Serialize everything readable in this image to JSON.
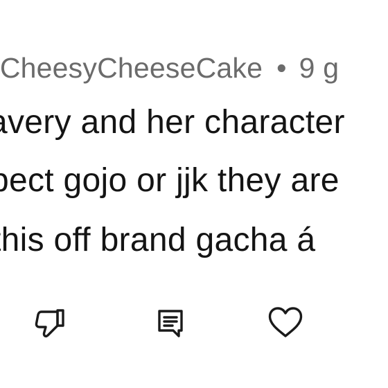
{
  "comment": {
    "author": "rCheesyCheeseCake",
    "separator": "•",
    "time": "9 g",
    "lines": [
      "avery and her character",
      "pect gojo or jjk they are",
      " this off brand  gacha á"
    ]
  },
  "actions": {
    "dislike_icon": "thumbs-down-icon",
    "reply_icon": "comment-icon",
    "like_icon": "heart-icon"
  }
}
